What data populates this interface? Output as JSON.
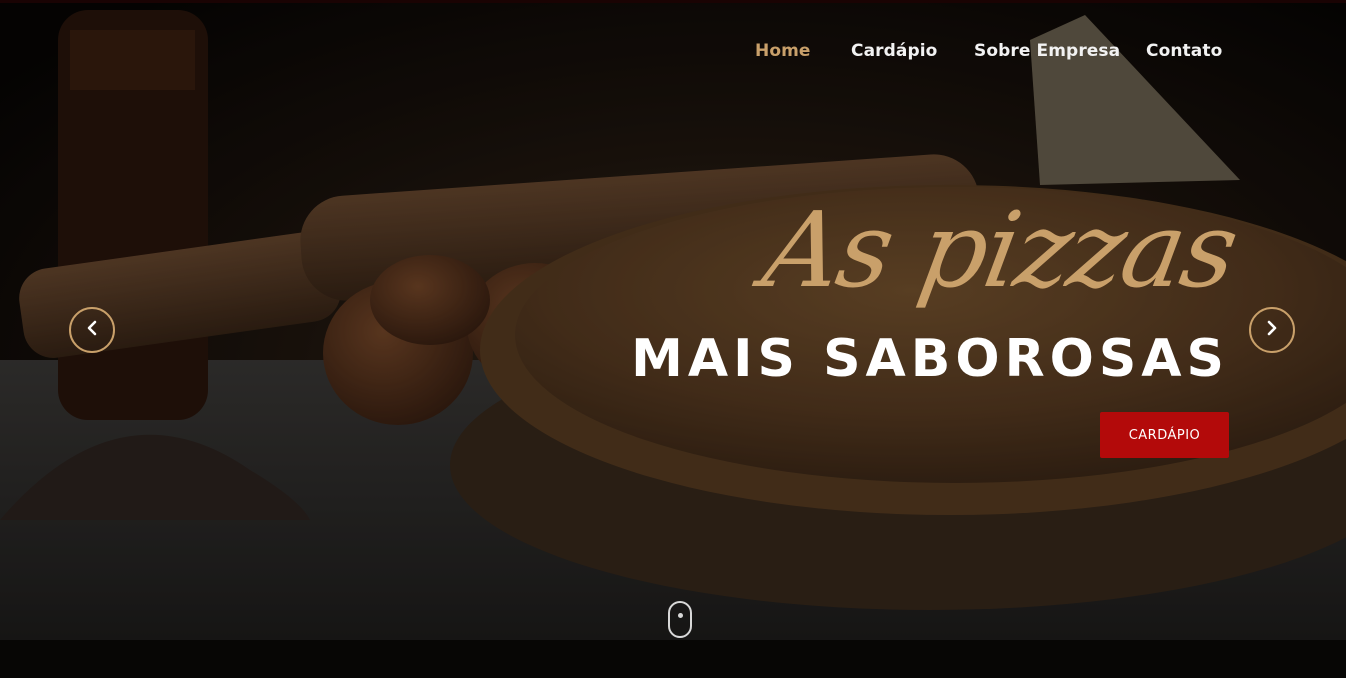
{
  "nav": {
    "items": [
      {
        "label": "Home",
        "active": true
      },
      {
        "label": "Cardápio",
        "active": false
      },
      {
        "label": "Sobre Empresa",
        "active": false
      },
      {
        "label": "Contato",
        "active": false
      }
    ]
  },
  "hero": {
    "script_title": "As pizzas",
    "main_title": "MAIS SABOROSAS",
    "cta_label": "CARDÁPIO"
  },
  "slider": {
    "prev_icon": "chevron-left-icon",
    "next_icon": "chevron-right-icon",
    "scroll_icon": "mouse-scroll-icon"
  },
  "colors": {
    "accent": "#c9a06a",
    "cta": "#b30a0a",
    "text": "#ffffff"
  }
}
